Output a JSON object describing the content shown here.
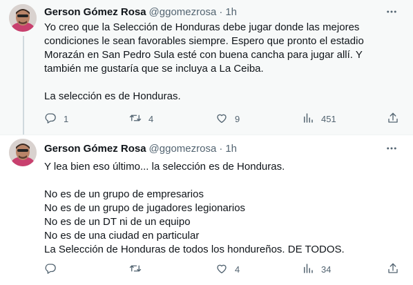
{
  "tweets": [
    {
      "author_name": "Gerson Gómez Rosa",
      "handle": "@ggomezrosa",
      "separator": "·",
      "time": "1h",
      "text_lines": [
        "Yo creo que la Selección de Honduras debe jugar donde las mejores",
        "condiciones le sean favorables siempre. Espero que pronto el estadio",
        "Morazán en San Pedro Sula esté con buena cancha para jugar allí. Y",
        "también me gustaría que se incluya a La Ceiba."
      ],
      "text_lines_2": [
        "La selección es de Honduras."
      ],
      "replies": "1",
      "retweets": "4",
      "likes": "9",
      "views": "451"
    },
    {
      "author_name": "Gerson Gómez Rosa",
      "handle": "@ggomezrosa",
      "separator": "·",
      "time": "1h",
      "text_lines": [
        "Y lea bien eso último... la selección es de Honduras."
      ],
      "text_lines_2": [
        "No es de un grupo de empresarios",
        "No es de un grupo de jugadores legionarios",
        "No es de un DT ni de un equipo",
        "No es de una ciudad en particular",
        "La Selección de Honduras de todos los hondureños. DE TODOS."
      ],
      "replies": "",
      "retweets": "",
      "likes": "4",
      "views": "34"
    }
  ],
  "icons": {
    "more": "more-horizontal-icon",
    "reply": "reply-icon",
    "retweet": "retweet-icon",
    "like": "heart-icon",
    "views": "views-icon",
    "share": "share-icon"
  },
  "colors": {
    "text": "#0f1419",
    "secondary": "#536471",
    "thread_line": "#cfd9de",
    "highlight_bg": "#f7f9f9"
  }
}
